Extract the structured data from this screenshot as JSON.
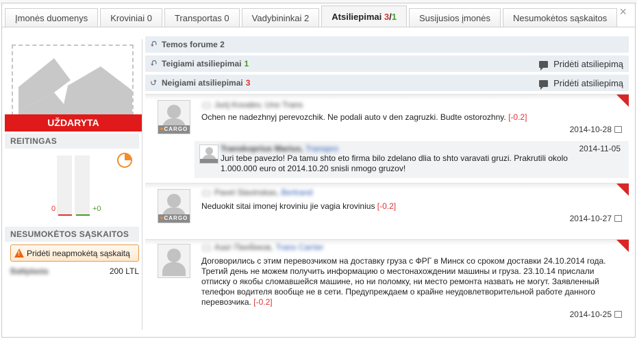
{
  "tabs": [
    {
      "label": "Įmonės duomenys"
    },
    {
      "label": "Kroviniai 0"
    },
    {
      "label": "Transportas 0"
    },
    {
      "label": "Vadybininkai 2"
    },
    {
      "label": "Atsiliepimai ",
      "count_a": "3",
      "sep": "/",
      "count_b": "1"
    },
    {
      "label": "Susijusios įmonės"
    },
    {
      "label": "Nesumokėtos sąskaitos"
    }
  ],
  "close_symbol": "×",
  "left": {
    "status": "UŽDARYTA",
    "rating_title": "REITINGAS",
    "rating_neg": "0",
    "rating_pos": "+0",
    "invoices_title": "NESUMOKĖTOS SĄSKAITOS",
    "add_invoice_label": "Pridėti neapmokėtą sąskaitą",
    "invoice_name": "Baltiplasta",
    "invoice_amount": "200 LTL"
  },
  "sections": {
    "forum": {
      "label": "Temos forume",
      "count": "2"
    },
    "positive": {
      "label": "Teigiami atsiliepimai",
      "count": "1",
      "add": "Pridėti atsiliepimą"
    },
    "negative": {
      "label": "Neigiami atsiliepimai",
      "count": "3",
      "add": "Pridėti atsiliepimą"
    }
  },
  "reviews": [
    {
      "author": "Jurij Kovalev, Uno Trans",
      "company": "",
      "text": "Ochen ne nadezhnyj perevozchik. Ne podali auto v den zagruzki. Budte ostorozhny.",
      "score": "[-0.2]",
      "date": "2014-10-28",
      "reply": {
        "author": "Transkoprius Marius, ",
        "company": "Transpro",
        "date": "2014-11-05",
        "text": "Juri tebe pavezlo! Pa tamu shto eto firma bilo zdelano dlia to shto varavati gruzi. Prakrutili okolo 1.000.000 euro ot 2014.10.20 snisli nmogo gruzov!"
      }
    },
    {
      "author": "Pavel Slavinskas, ",
      "company": "Bertrand",
      "text": "Neduokit sitai imonej kroviniu jie vagia krovinius",
      "score": "[-0.2]",
      "date": "2014-10-27"
    },
    {
      "author": "Азат Пинбеков, ",
      "company": "Trans Carrier",
      "text": "Договорились с этим перевозчиком на доставку груза с ФРГ в Минск со сроком доставки 24.10.2014 года. Третий день не можем получить информацию о местонахождении машины и груза. 23.10.14 прислали отписку о якобы сломавшейся машине, но ни поломку, ни место ремонта назвать не могут. Заявленный телефон водителя вообще не в сети. Предупреждаем о крайне неудовлетворительной работе данного перевозчика.",
      "score": "[-0.2]",
      "date": "2014-10-25"
    }
  ],
  "colors": {
    "status_red": "#e01a1a",
    "negative_red": "#dd3333",
    "positive_green": "#4a9a2a",
    "link_blue": "#2a58b0",
    "section_bg": "#e9eef3",
    "accent_orange": "#f28c28"
  }
}
